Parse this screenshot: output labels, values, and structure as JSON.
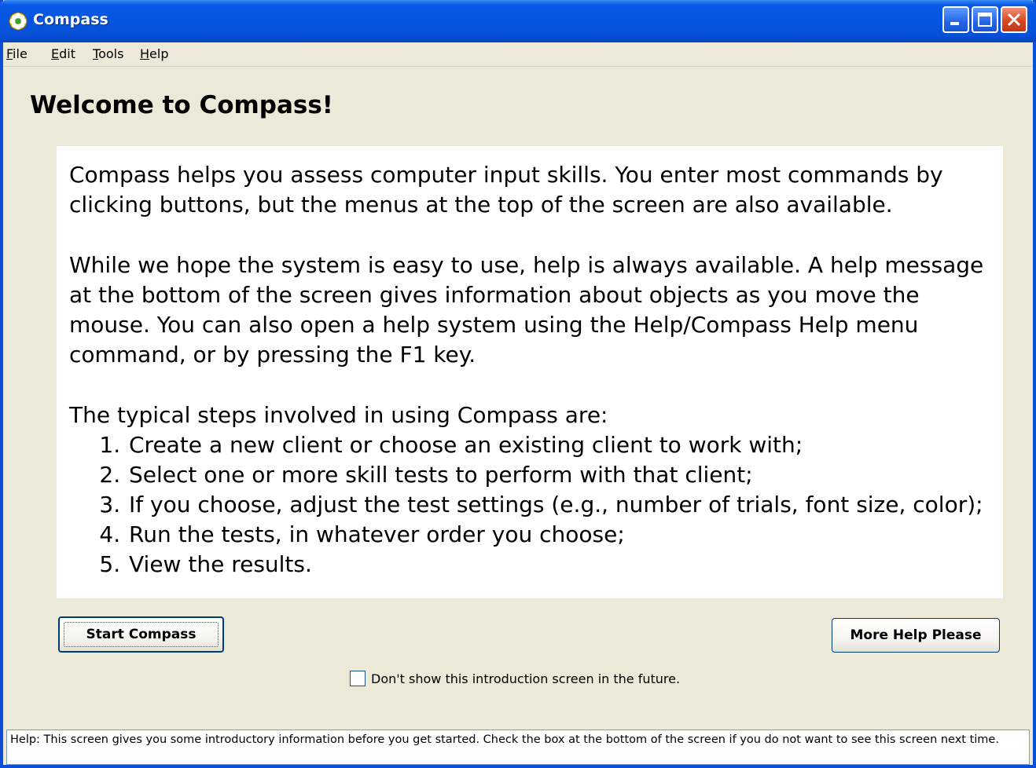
{
  "window": {
    "title": "Compass",
    "icon": "compass-flower-icon",
    "controls": [
      "minimize-icon",
      "maximize-icon",
      "close-icon"
    ]
  },
  "menu": {
    "file": {
      "accel": "F",
      "rest": "ile"
    },
    "edit": {
      "accel": "E",
      "rest": "dit"
    },
    "tools": {
      "accel": "T",
      "rest": "ools"
    },
    "help": {
      "accel": "H",
      "rest": "elp"
    }
  },
  "welcome": {
    "heading": "Welcome to Compass!"
  },
  "intro": {
    "paragraph1": "Compass helps you assess computer input skills.  You enter most commands by clicking buttons, but the menus at the top of the screen are also available.",
    "paragraph2": "While we hope the system is easy to use, help is always available.  A help message at the bottom of the screen gives information about objects as you move the mouse.  You can also open a help system using the Help/Compass Help menu command, or by pressing the F1 key.",
    "steps_intro": "The typical steps involved in using Compass are:",
    "steps": [
      "Create a new client or choose an existing client to work with;",
      "Select one or more skill tests to perform with that client;",
      "If you choose, adjust the test settings (e.g., number of trials, font size, color);",
      "Run the tests, in whatever order you choose;",
      "View the results."
    ]
  },
  "buttons": {
    "start": "Start Compass",
    "more_help": "More Help Please"
  },
  "checkbox": {
    "label": "Don't show this introduction screen in the future.",
    "checked": false
  },
  "status": {
    "text": "Help:  This screen gives you some introductory information before you get started.  Check the box at the bottom of the screen if you do not want to see this screen next time."
  }
}
